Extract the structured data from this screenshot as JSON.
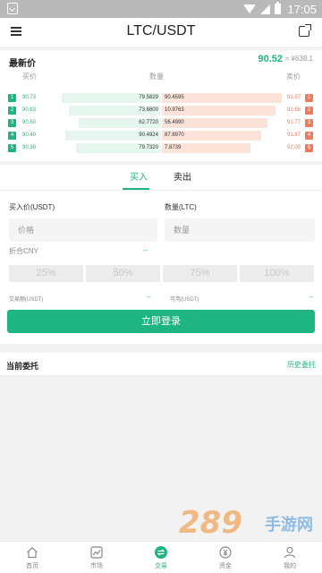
{
  "status_bar": {
    "time": "17:05"
  },
  "header": {
    "title": "LTC/USDT"
  },
  "market": {
    "latest_label": "最新价",
    "latest_price": "90.52",
    "cny_approx": "≈ ¥638.1",
    "col_buy_price": "买价",
    "col_quantity": "数量",
    "col_sell_price": "卖价",
    "order_book": [
      {
        "rank": "1",
        "buy_price": "90.73",
        "buy_qty": "79.5829",
        "sell_qty": "90.4595",
        "sell_price": "91.57",
        "buy_depth": 0.85,
        "sell_depth": 0.88
      },
      {
        "rank": "2",
        "buy_price": "90.63",
        "buy_qty": "73.6600",
        "sell_qty": "10.9763",
        "sell_price": "91.68",
        "buy_depth": 0.79,
        "sell_depth": 0.82
      },
      {
        "rank": "3",
        "buy_price": "90.50",
        "buy_qty": "62.7720",
        "sell_qty": "56.4990",
        "sell_price": "91.77",
        "buy_depth": 0.71,
        "sell_depth": 0.75
      },
      {
        "rank": "4",
        "buy_price": "90.40",
        "buy_qty": "90.4924",
        "sell_qty": "87.8970",
        "sell_price": "91.87",
        "buy_depth": 0.82,
        "sell_depth": 0.7
      },
      {
        "rank": "5",
        "buy_price": "90.30",
        "buy_qty": "79.7320",
        "sell_qty": "7.8739",
        "sell_price": "92.00",
        "buy_depth": 0.73,
        "sell_depth": 0.61
      }
    ]
  },
  "trade": {
    "tab_buy": "买入",
    "tab_sell": "卖出",
    "price_label": "买入价(USDT)",
    "qty_label": "数量(LTC)",
    "price_placeholder": "价格",
    "qty_placeholder": "数量",
    "cny_label": "折合CNY",
    "cny_value": "--",
    "percents": [
      "25%",
      "50%",
      "75%",
      "100%"
    ],
    "turnover_label": "交易额(USDT)",
    "turnover_value": "--",
    "available_label": "可用(USDT)",
    "available_value": "--",
    "login_button": "立即登录"
  },
  "orders": {
    "current_label": "当前委托",
    "history_link": "历史委托"
  },
  "watermark": {
    "brand": "289",
    "suffix": "手游网"
  },
  "nav": [
    {
      "label": "首页",
      "icon": "home-icon",
      "active": false
    },
    {
      "label": "市场",
      "icon": "chart-icon",
      "active": false
    },
    {
      "label": "交易",
      "icon": "exchange-icon",
      "active": true
    },
    {
      "label": "资金",
      "icon": "yen-icon",
      "active": false
    },
    {
      "label": "我的",
      "icon": "user-icon",
      "active": false
    }
  ],
  "colors": {
    "accent": "#1fb583",
    "sell": "#ef7a5e"
  }
}
